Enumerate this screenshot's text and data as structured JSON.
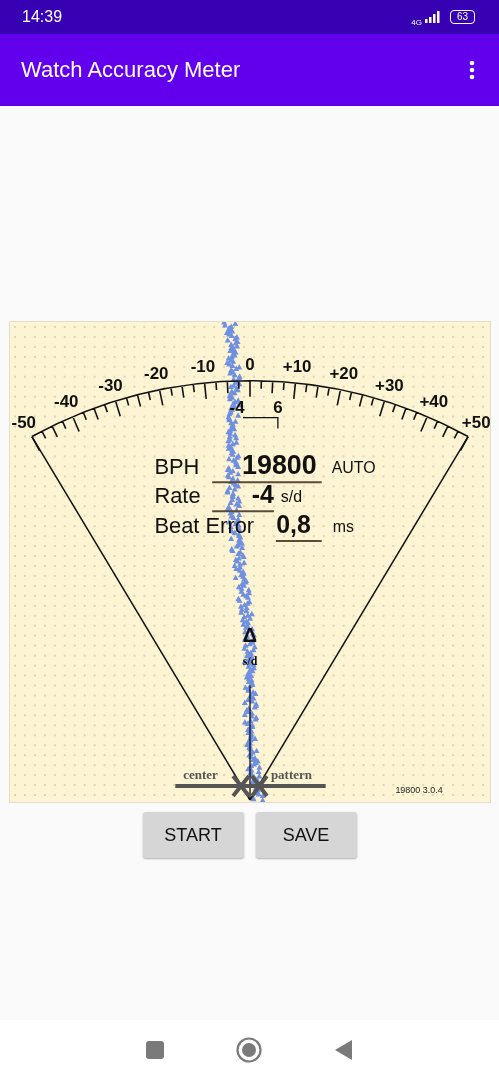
{
  "status_bar": {
    "time": "14:39",
    "network": "4G",
    "battery": "63"
  },
  "app_bar": {
    "title": "Watch Accuracy Meter"
  },
  "meter": {
    "scale_labels": [
      "-50",
      "-40",
      "-30",
      "-20",
      "-10",
      "0",
      "+10",
      "+20",
      "+30",
      "+40",
      "+50"
    ],
    "marker_labels": [
      "-4",
      "6"
    ],
    "readout": [
      {
        "label": "BPH",
        "value": "19800",
        "unit": "AUTO"
      },
      {
        "label": "Rate",
        "value": "-4",
        "unit": "s/d"
      },
      {
        "label": "Beat Error",
        "value": "0,8",
        "unit": "ms"
      }
    ],
    "delta_symbol": "Δ",
    "delta_unit": "s/d",
    "center_label": "center",
    "pattern_label": "pattern",
    "version": "19800 3.0.4"
  },
  "buttons": [
    "START",
    "SAVE"
  ]
}
